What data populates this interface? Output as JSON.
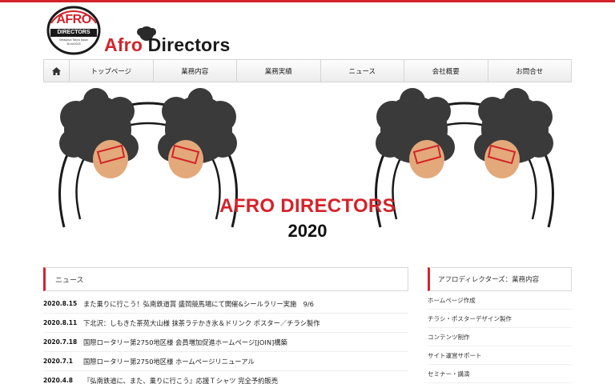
{
  "header": {
    "logo_text_top": "AFRO",
    "logo_text_bottom": "DIRECTORS",
    "logo_small": "Setagaya Tokyo Japan",
    "logo_since": "Since2003",
    "brand_afro": "Afro",
    "brand_directors": " Directors",
    "accent_color": "#d4232a"
  },
  "nav": {
    "home_icon": "home-icon",
    "items": [
      {
        "label": "トップページ"
      },
      {
        "label": "業務内容"
      },
      {
        "label": "業務実績"
      },
      {
        "label": "ニュース"
      },
      {
        "label": "会社概要"
      },
      {
        "label": "お問合せ"
      }
    ]
  },
  "hero": {
    "title": "AFRO DIRECTORS",
    "year": "2020"
  },
  "news": {
    "heading": "ニュース",
    "items": [
      {
        "date": "2020.8.15",
        "title": "また乗りに行こう！弘南鉄道賞 盛岡競馬場にて開催&シールラリー実施　9/6"
      },
      {
        "date": "2020.8.11",
        "title": "下北沢：しもきた茶苑大山様 抹茶ラテかき氷＆ドリンク ポスター／チラシ製作"
      },
      {
        "date": "2020.7.18",
        "title": "国際ロータリー第2750地区様 会員増加促進ホームページ[JOIN]構築"
      },
      {
        "date": "2020.7.1",
        "title": "国際ロータリー第2750地区様 ホームページリニューアル"
      },
      {
        "date": "2020.4.8",
        "title": "『弘南鉄道に、また、乗りに行こう』応援Ｔシャツ 完全予約販売"
      }
    ]
  },
  "sidebar": {
    "heading": "アフロディレクターズ：業務内容",
    "items": [
      {
        "label": "ホームページ作成"
      },
      {
        "label": "チラシ・ポスターデザイン製作"
      },
      {
        "label": "コンテンツ制作"
      },
      {
        "label": "サイト運営サポート"
      },
      {
        "label": "セミナー・講演"
      }
    ]
  }
}
